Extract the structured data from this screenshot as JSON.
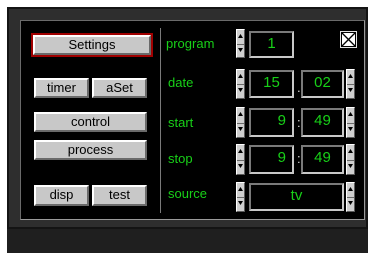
{
  "buttons": {
    "settings": "Settings",
    "timer": "timer",
    "aset": "aSet",
    "control": "control",
    "process": "process",
    "disp": "disp",
    "test": "test"
  },
  "labels": {
    "program": "program",
    "date": "date",
    "start": "start",
    "stop": "stop",
    "source": "source"
  },
  "values": {
    "program": "1",
    "date_day": "15",
    "date_month": "02",
    "start_hour": "9",
    "start_min": "49",
    "stop_hour": "9",
    "stop_min": "49",
    "source": "tv"
  },
  "separators": {
    "date": ".",
    "start": ":",
    "stop": ":"
  },
  "colors": {
    "text_green": "#18d018",
    "panel": "#000000",
    "button_face": "#c8c8c8",
    "active_outline": "#a00000"
  },
  "icons": {
    "close": "close-x-icon",
    "spin_up": "triangle-up-icon",
    "spin_down": "triangle-down-icon"
  }
}
